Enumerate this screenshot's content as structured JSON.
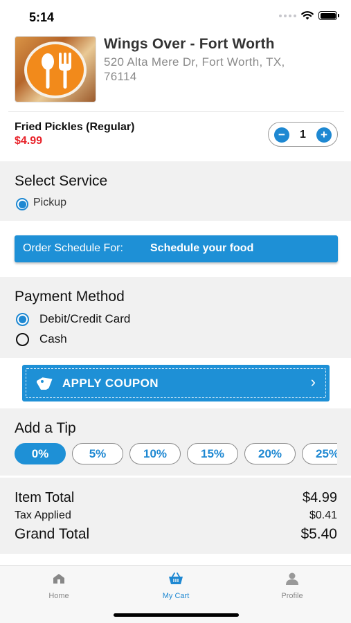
{
  "status_bar": {
    "time": "5:14"
  },
  "restaurant": {
    "name": "Wings Over - Fort Worth",
    "address": "520 Alta Mere Dr, Fort Worth, TX, 76114"
  },
  "cart_item": {
    "name": "Fried Pickles (Regular)",
    "price": "$4.99",
    "quantity": "1",
    "minus": "−",
    "plus": "+"
  },
  "service": {
    "title": "Select Service",
    "options": [
      {
        "label": "Pickup",
        "selected": true
      }
    ]
  },
  "schedule": {
    "prefix": "Order Schedule For:",
    "value": "Schedule your food"
  },
  "payment": {
    "title": "Payment Method",
    "options": [
      {
        "label": "Debit/Credit Card",
        "selected": true
      },
      {
        "label": "Cash",
        "selected": false
      }
    ]
  },
  "coupon": {
    "label": "APPLY COUPON",
    "icon": "tag-icon"
  },
  "tip": {
    "title": "Add a Tip",
    "options": [
      "0%",
      "5%",
      "10%",
      "15%",
      "20%",
      "25%"
    ],
    "selected": "0%"
  },
  "totals": {
    "item_total_label": "Item Total",
    "item_total": "$4.99",
    "tax_label": "Tax Applied",
    "tax": "$0.41",
    "grand_total_label": "Grand Total",
    "grand_total": "$5.40"
  },
  "tabs": [
    {
      "label": "Home",
      "icon": "home-icon",
      "active": false
    },
    {
      "label": "My Cart",
      "icon": "basket-icon",
      "active": true
    },
    {
      "label": "Profile",
      "icon": "person-icon",
      "active": false
    }
  ],
  "colors": {
    "accent": "#1e90d6",
    "price": "#e8232a",
    "logo": "#f28a1b"
  }
}
